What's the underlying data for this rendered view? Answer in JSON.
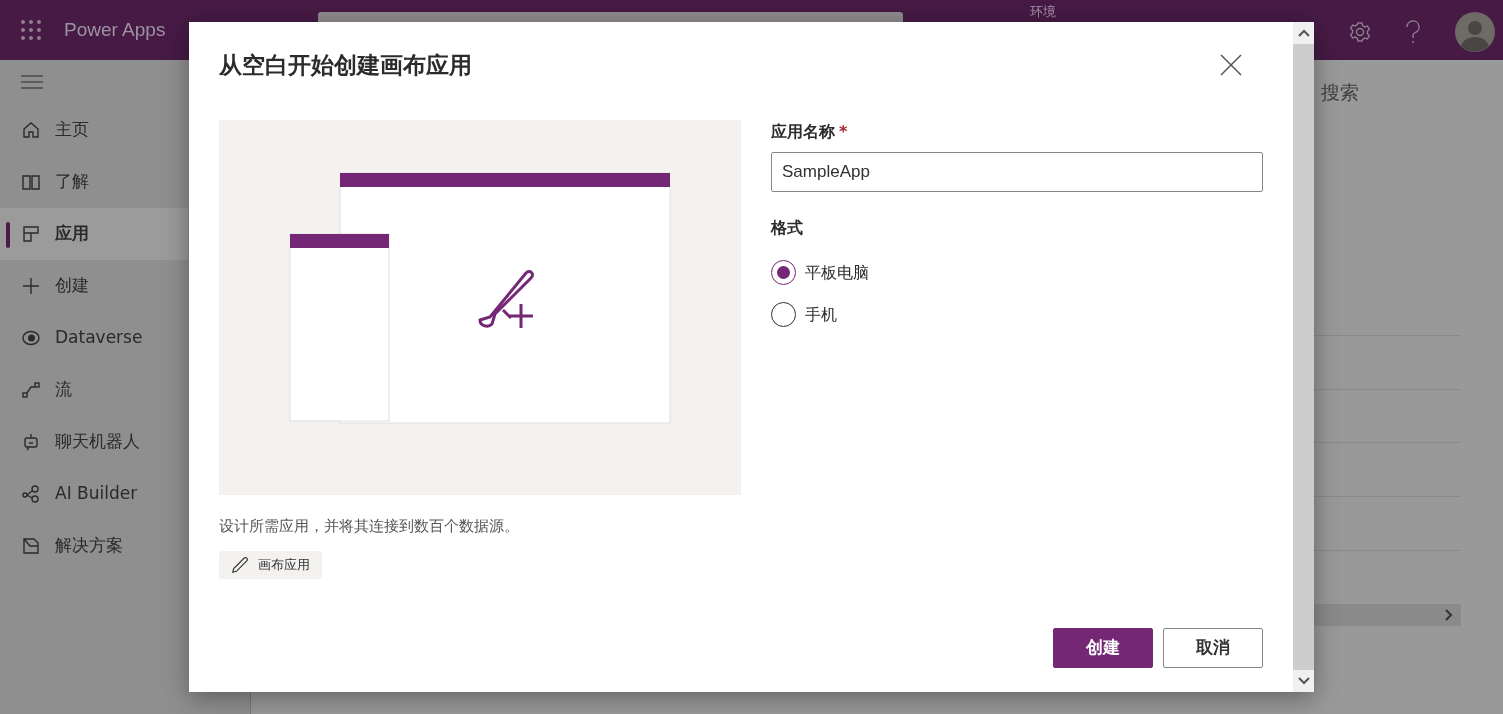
{
  "header": {
    "app_name": "Power Apps",
    "environment_label": "环境"
  },
  "sidebar": {
    "items": [
      {
        "label": "主页",
        "selected": false
      },
      {
        "label": "了解",
        "selected": false
      },
      {
        "label": "应用",
        "selected": true
      },
      {
        "label": "创建",
        "selected": false
      },
      {
        "label": "Dataverse",
        "selected": false
      },
      {
        "label": "流",
        "selected": false
      },
      {
        "label": "聊天机器人",
        "selected": false
      },
      {
        "label": "AI Builder",
        "selected": false
      },
      {
        "label": "解决方案",
        "selected": false
      }
    ]
  },
  "main": {
    "search_label": "搜索"
  },
  "dialog": {
    "title": "从空白开始创建画布应用",
    "description": "设计所需应用，并将其连接到数百个数据源。",
    "tag": "画布应用",
    "name_field": {
      "label": "应用名称",
      "required_mark": "*",
      "value": "SampleApp"
    },
    "format": {
      "label": "格式",
      "options": [
        {
          "label": "平板电脑",
          "selected": true
        },
        {
          "label": "手机",
          "selected": false
        }
      ]
    },
    "buttons": [
      {
        "label": "创建",
        "kind": "primary"
      },
      {
        "label": "取消",
        "kind": "secondary"
      }
    ]
  }
}
